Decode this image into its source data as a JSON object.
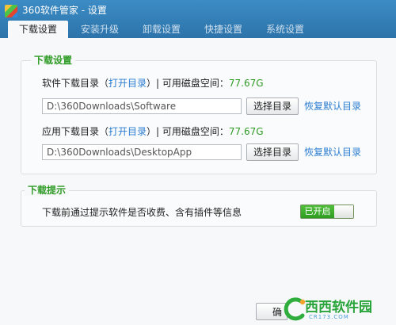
{
  "window": {
    "title": "360软件管家 - 设置"
  },
  "tabs": [
    {
      "label": "下载设置",
      "active": true
    },
    {
      "label": "安装升级",
      "active": false
    },
    {
      "label": "卸载设置",
      "active": false
    },
    {
      "label": "快捷设置",
      "active": false
    },
    {
      "label": "系统设置",
      "active": false
    }
  ],
  "download_settings": {
    "title": "下载设置",
    "software": {
      "label": "软件下载目录（",
      "open_link": "打开目录",
      "separator": "）| 可用磁盘空间：",
      "space": "77.67G",
      "path": "D:\\360Downloads\\Software",
      "choose_button": "选择目录",
      "restore_link": "恢复默认目录"
    },
    "app": {
      "label": "应用下载目录（",
      "open_link": "打开目录",
      "separator": "）| 可用磁盘空间：",
      "space": "77.67G",
      "path": "D:\\360Downloads\\DesktopApp",
      "choose_button": "选择目录",
      "restore_link": "恢复默认目录"
    }
  },
  "download_tips": {
    "title": "下载提示",
    "description": "下载前通过提示软件是否收费、含有插件等信息",
    "toggle_label": "已开启",
    "enabled": true
  },
  "bottom": {
    "button_partial": "确"
  },
  "watermark": {
    "text": "西西软件园",
    "sub": "CR173.COM"
  },
  "colors": {
    "accent_green": "#2f9b26",
    "link_blue": "#2c7dd0",
    "titlebar": "#2f78b0"
  }
}
